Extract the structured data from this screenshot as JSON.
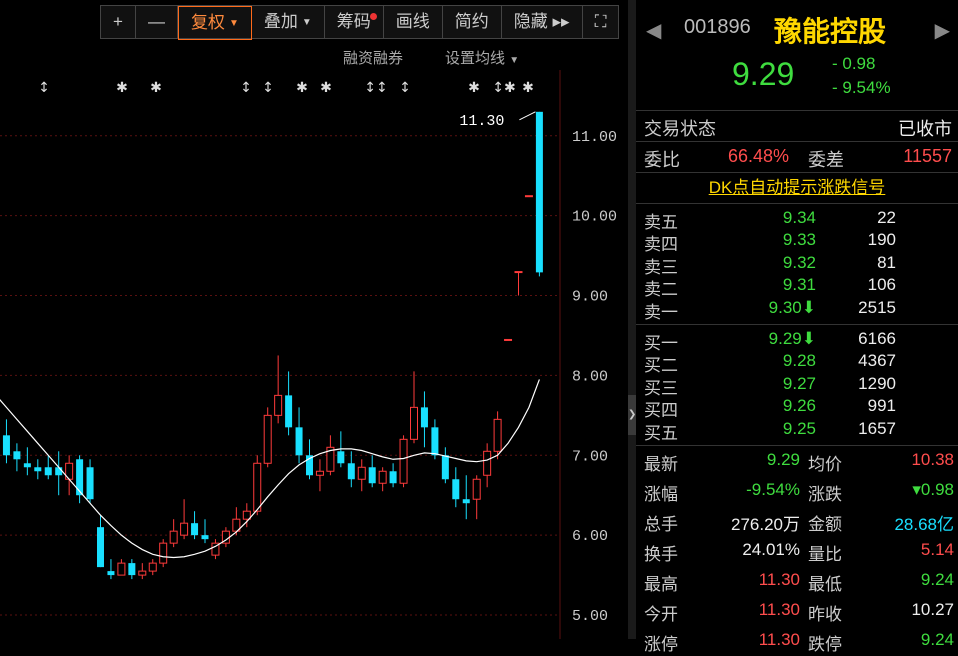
{
  "toolbar": {
    "items": [
      {
        "label": "+"
      },
      {
        "label": "—"
      },
      {
        "label": "复权"
      },
      {
        "label": "叠加"
      },
      {
        "label": "筹码"
      },
      {
        "label": "画线"
      },
      {
        "label": "简约"
      },
      {
        "label": "隐藏"
      }
    ],
    "hide_arrow": "▸▸",
    "expand_icon": "⛶"
  },
  "subbar": {
    "margin_label": "融资融券",
    "ma_label": "设置均线"
  },
  "chart_data": {
    "type": "candlestick",
    "ylabels": [
      "11.00",
      "10.00",
      "9.00",
      "8.00",
      "7.00",
      "6.00",
      "5.00"
    ],
    "ylim": [
      4.7,
      12.7
    ],
    "high_annotation": "11.30",
    "candles": [
      {
        "o": 7.35,
        "h": 7.55,
        "l": 7.1,
        "c": 7.15
      },
      {
        "o": 7.25,
        "h": 7.45,
        "l": 6.9,
        "c": 7.0
      },
      {
        "o": 7.05,
        "h": 7.15,
        "l": 6.8,
        "c": 6.95
      },
      {
        "o": 6.9,
        "h": 7.1,
        "l": 6.75,
        "c": 6.85
      },
      {
        "o": 6.85,
        "h": 6.95,
        "l": 6.7,
        "c": 6.8
      },
      {
        "o": 6.85,
        "h": 7.0,
        "l": 6.7,
        "c": 6.75
      },
      {
        "o": 6.85,
        "h": 7.05,
        "l": 6.5,
        "c": 6.75
      },
      {
        "o": 6.7,
        "h": 7.0,
        "l": 6.5,
        "c": 6.9
      },
      {
        "o": 6.95,
        "h": 7.0,
        "l": 6.4,
        "c": 6.5
      },
      {
        "o": 6.85,
        "h": 6.95,
        "l": 6.4,
        "c": 6.45
      },
      {
        "o": 6.1,
        "h": 6.25,
        "l": 5.6,
        "c": 5.6
      },
      {
        "o": 5.55,
        "h": 5.7,
        "l": 5.45,
        "c": 5.5
      },
      {
        "o": 5.5,
        "h": 5.7,
        "l": 5.5,
        "c": 5.65
      },
      {
        "o": 5.65,
        "h": 5.7,
        "l": 5.45,
        "c": 5.5
      },
      {
        "o": 5.5,
        "h": 5.65,
        "l": 5.45,
        "c": 5.55
      },
      {
        "o": 5.55,
        "h": 5.7,
        "l": 5.5,
        "c": 5.65
      },
      {
        "o": 5.65,
        "h": 5.95,
        "l": 5.6,
        "c": 5.9
      },
      {
        "o": 5.9,
        "h": 6.2,
        "l": 5.85,
        "c": 6.05
      },
      {
        "o": 6.0,
        "h": 6.45,
        "l": 5.95,
        "c": 6.15
      },
      {
        "o": 6.15,
        "h": 6.3,
        "l": 5.95,
        "c": 6.0
      },
      {
        "o": 6.0,
        "h": 6.2,
        "l": 5.9,
        "c": 5.95
      },
      {
        "o": 5.75,
        "h": 5.95,
        "l": 5.7,
        "c": 5.9
      },
      {
        "o": 5.9,
        "h": 6.1,
        "l": 5.85,
        "c": 6.05
      },
      {
        "o": 6.05,
        "h": 6.35,
        "l": 6.0,
        "c": 6.2
      },
      {
        "o": 6.2,
        "h": 6.4,
        "l": 6.1,
        "c": 6.3
      },
      {
        "o": 6.3,
        "h": 7.0,
        "l": 6.25,
        "c": 6.9
      },
      {
        "o": 6.9,
        "h": 7.6,
        "l": 6.85,
        "c": 7.5
      },
      {
        "o": 7.5,
        "h": 8.25,
        "l": 7.4,
        "c": 7.75
      },
      {
        "o": 7.75,
        "h": 8.05,
        "l": 7.25,
        "c": 7.35
      },
      {
        "o": 7.35,
        "h": 7.6,
        "l": 6.9,
        "c": 7.0
      },
      {
        "o": 7.0,
        "h": 7.2,
        "l": 6.7,
        "c": 6.75
      },
      {
        "o": 6.75,
        "h": 6.95,
        "l": 6.55,
        "c": 6.8
      },
      {
        "o": 6.8,
        "h": 7.25,
        "l": 6.75,
        "c": 7.1
      },
      {
        "o": 7.05,
        "h": 7.3,
        "l": 6.85,
        "c": 6.9
      },
      {
        "o": 6.9,
        "h": 7.05,
        "l": 6.6,
        "c": 6.7
      },
      {
        "o": 6.7,
        "h": 6.95,
        "l": 6.55,
        "c": 6.85
      },
      {
        "o": 6.85,
        "h": 7.0,
        "l": 6.6,
        "c": 6.65
      },
      {
        "o": 6.65,
        "h": 6.85,
        "l": 6.55,
        "c": 6.8
      },
      {
        "o": 6.8,
        "h": 6.9,
        "l": 6.6,
        "c": 6.65
      },
      {
        "o": 6.65,
        "h": 7.25,
        "l": 6.6,
        "c": 7.2
      },
      {
        "o": 7.2,
        "h": 8.05,
        "l": 7.15,
        "c": 7.6
      },
      {
        "o": 7.6,
        "h": 7.8,
        "l": 7.1,
        "c": 7.35
      },
      {
        "o": 7.35,
        "h": 7.45,
        "l": 6.95,
        "c": 7.0
      },
      {
        "o": 7.0,
        "h": 7.1,
        "l": 6.65,
        "c": 6.7
      },
      {
        "o": 6.7,
        "h": 6.85,
        "l": 6.35,
        "c": 6.45
      },
      {
        "o": 6.45,
        "h": 6.75,
        "l": 6.2,
        "c": 6.4
      },
      {
        "o": 6.45,
        "h": 6.75,
        "l": 6.2,
        "c": 6.7
      },
      {
        "o": 6.75,
        "h": 7.15,
        "l": 6.6,
        "c": 7.05
      },
      {
        "o": 7.05,
        "h": 7.55,
        "l": 6.95,
        "c": 7.45
      },
      {
        "o": 8.45,
        "h": 8.45,
        "l": 8.45,
        "c": 8.45
      },
      {
        "o": 9.3,
        "h": 9.3,
        "l": 9.0,
        "c": 9.3
      },
      {
        "o": 10.25,
        "h": 10.25,
        "l": 10.25,
        "c": 10.25
      },
      {
        "o": 11.3,
        "h": 11.3,
        "l": 9.24,
        "c": 9.29
      }
    ],
    "ma": [
      7.75,
      7.6,
      7.45,
      7.3,
      7.15,
      7.0,
      6.85,
      6.7,
      6.55,
      6.4,
      6.25,
      6.12,
      6.0,
      5.9,
      5.82,
      5.76,
      5.73,
      5.72,
      5.73,
      5.76,
      5.8,
      5.86,
      5.94,
      6.04,
      6.17,
      6.32,
      6.48,
      6.63,
      6.77,
      6.88,
      6.96,
      7.02,
      7.06,
      7.08,
      7.08,
      7.06,
      7.02,
      6.98,
      6.95,
      6.96,
      7.0,
      7.03,
      7.02,
      6.99,
      6.96,
      6.93,
      6.92,
      6.94,
      7.0,
      7.15,
      7.35,
      7.6,
      7.95
    ]
  },
  "marker_icons": [
    "↕",
    "✱",
    "✱",
    "↕",
    "↕",
    "✱",
    "✱",
    "↕↕",
    "↕",
    "✱",
    "↕✱",
    "✱"
  ],
  "quote": {
    "code": "001896",
    "name": "豫能控股",
    "price": "9.29",
    "change": "- 0.98",
    "change_pct": "- 9.54%"
  },
  "status": {
    "label": "交易状态",
    "value": "已收市"
  },
  "ratio": {
    "label": "委比",
    "value": "66.48%",
    "diff_label": "委差",
    "diff_value": "11557"
  },
  "dk_link": "DK点自动提示涨跌信号",
  "asks": [
    {
      "name": "卖五",
      "price": "9.34",
      "vol": "22"
    },
    {
      "name": "卖四",
      "price": "9.33",
      "vol": "190"
    },
    {
      "name": "卖三",
      "price": "9.32",
      "vol": "81"
    },
    {
      "name": "卖二",
      "price": "9.31",
      "vol": "106"
    },
    {
      "name": "卖一",
      "price": "9.30⬇",
      "vol": "2515"
    }
  ],
  "bids": [
    {
      "name": "买一",
      "price": "9.29⬇",
      "vol": "6166"
    },
    {
      "name": "买二",
      "price": "9.28",
      "vol": "4367"
    },
    {
      "name": "买三",
      "price": "9.27",
      "vol": "1290"
    },
    {
      "name": "买四",
      "price": "9.26",
      "vol": "991"
    },
    {
      "name": "买五",
      "price": "9.25",
      "vol": "1657"
    }
  ],
  "stats": [
    {
      "l1": "最新",
      "v1": "9.29",
      "c1": "green",
      "l2": "均价",
      "v2": "10.38",
      "c2": "red"
    },
    {
      "l1": "涨幅",
      "v1": "-9.54%",
      "c1": "green",
      "l2": "涨跌",
      "v2": "▾0.98",
      "c2": "green"
    },
    {
      "l1": "总手",
      "v1": "276.20万",
      "c1": "white",
      "l2": "金额",
      "v2": "28.68亿",
      "c2": "cyan"
    },
    {
      "l1": "换手",
      "v1": "24.01%",
      "c1": "white",
      "l2": "量比",
      "v2": "5.14",
      "c2": "red"
    },
    {
      "l1": "最高",
      "v1": "11.30",
      "c1": "red",
      "l2": "最低",
      "v2": "9.24",
      "c2": "green"
    },
    {
      "l1": "今开",
      "v1": "11.30",
      "c1": "red",
      "l2": "昨收",
      "v2": "10.27",
      "c2": "white"
    },
    {
      "l1": "涨停",
      "v1": "11.30",
      "c1": "red",
      "l2": "跌停",
      "v2": "9.24",
      "c2": "green"
    }
  ],
  "colors": {
    "up": "#ff3b3b",
    "down": "#19e0ff",
    "ma": "#ffffff",
    "grid": "#5a1010"
  }
}
